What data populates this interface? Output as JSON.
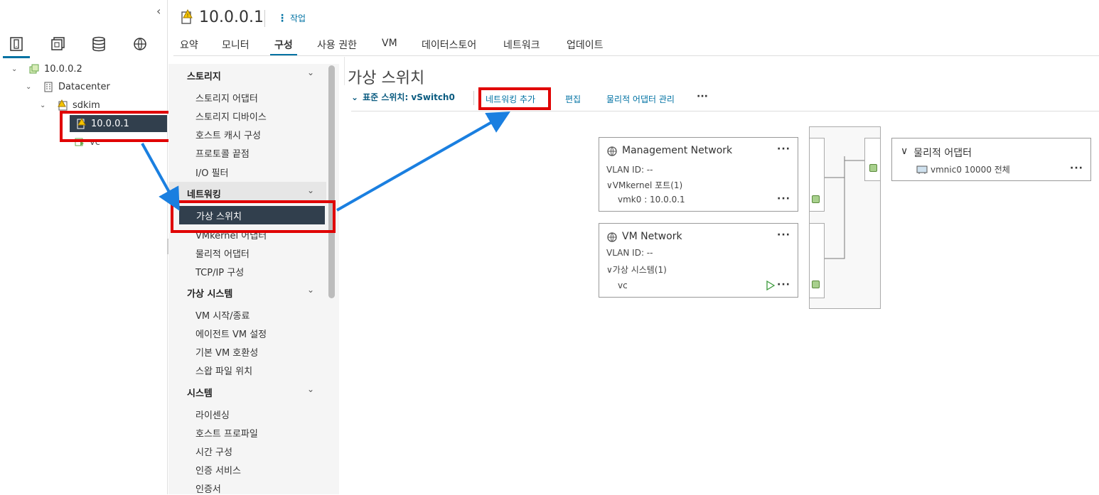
{
  "host_title": "10.0.0.1",
  "actions_label": "작업",
  "tabs": [
    "요약",
    "모니터",
    "구성",
    "사용 권한",
    "VM",
    "데이터스토어",
    "네트워크",
    "업데이트"
  ],
  "tree": {
    "vcenter": "10.0.0.2",
    "datacenter": "Datacenter",
    "cluster": "sdkim",
    "host": "10.0.0.1",
    "vm": "vc"
  },
  "config_menu": {
    "storage": {
      "title": "스토리지",
      "items": [
        "스토리지 어댑터",
        "스토리지 디바이스",
        "호스트 캐시 구성",
        "프로토콜 끝점",
        "I/O 필터"
      ]
    },
    "networking": {
      "title": "네트워킹",
      "items": [
        "가상 스위치",
        "VMkernel 어댑터",
        "물리적 어댑터",
        "TCP/IP 구성"
      ]
    },
    "vms": {
      "title": "가상 시스템",
      "items": [
        "VM 시작/종료",
        "에이전트 VM 설정",
        "기본 VM 호환성",
        "스왑 파일 위치"
      ]
    },
    "system": {
      "title": "시스템",
      "items": [
        "라이센싱",
        "호스트 프로파일",
        "시간 구성",
        "인증 서비스",
        "인증서"
      ]
    }
  },
  "main": {
    "title": "가상 스위치",
    "switch_label": "표준 스위치: vSwitch0",
    "add_networking": "네트워킹 추가",
    "edit": "편집",
    "manage_physical": "물리적 어댑터 관리",
    "more": "···"
  },
  "portgroups": [
    {
      "name": "Management Network",
      "vlan": "VLAN ID: --",
      "sub_label": "VMkernel 포트(1)",
      "sub_item": "vmk0 : 10.0.0.1"
    },
    {
      "name": "VM Network",
      "vlan": "VLAN ID: --",
      "sub_label": "가상 시스템(1)",
      "sub_item": "vc"
    }
  ],
  "physical": {
    "title": "물리적 어댑터",
    "nic": "vmnic0 10000 전체"
  },
  "colors": {
    "accent": "#0072a3",
    "selected": "#313f4d",
    "highlight": "#e00000",
    "arrow": "#1a7fe0"
  }
}
